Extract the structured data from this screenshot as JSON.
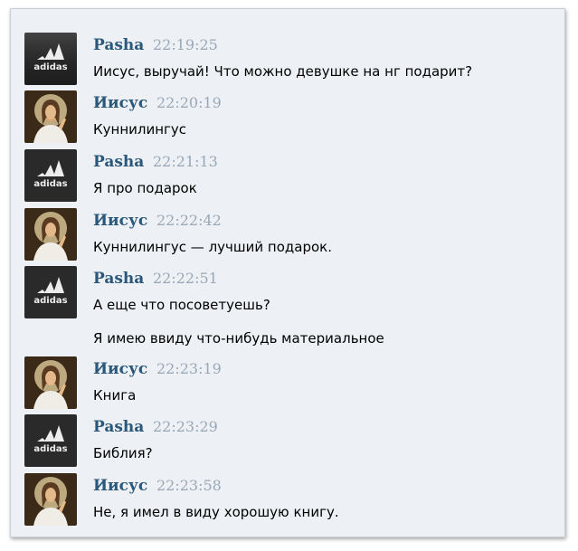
{
  "messages": [
    {
      "author": "Pasha",
      "time": "22:19:25",
      "avatar": "adidas-logo-icon",
      "lines": [
        "Иисус, выручай! Что можно девушке на нг подарит?"
      ]
    },
    {
      "author": "Иисус",
      "time": "22:20:19",
      "avatar": "jesus-portrait-icon",
      "lines": [
        "Куннилингус"
      ]
    },
    {
      "author": "Pasha",
      "time": "22:21:13",
      "avatar": "adidas-logo-icon",
      "lines": [
        "Я про подарок"
      ]
    },
    {
      "author": "Иисус",
      "time": "22:22:42",
      "avatar": "jesus-portrait-icon",
      "lines": [
        "Куннилингус — лучший подарок."
      ]
    },
    {
      "author": "Pasha",
      "time": "22:22:51",
      "avatar": "adidas-logo-icon",
      "lines": [
        "А еще что посоветуешь?",
        "Я имею ввиду что-нибудь материальное"
      ]
    },
    {
      "author": "Иисус",
      "time": "22:23:19",
      "avatar": "jesus-portrait-icon",
      "lines": [
        "Книга"
      ]
    },
    {
      "author": "Pasha",
      "time": "22:23:29",
      "avatar": "adidas-logo-icon",
      "lines": [
        "Библия?"
      ]
    },
    {
      "author": "Иисус",
      "time": "22:23:58",
      "avatar": "jesus-portrait-icon",
      "lines": [
        "Не, я имел в виду хорошую книгу."
      ]
    }
  ],
  "adidas_logo_text": "adidas",
  "colors": {
    "name": "#2b587a",
    "time": "#9aa7b6",
    "background": "#edf1f5"
  }
}
